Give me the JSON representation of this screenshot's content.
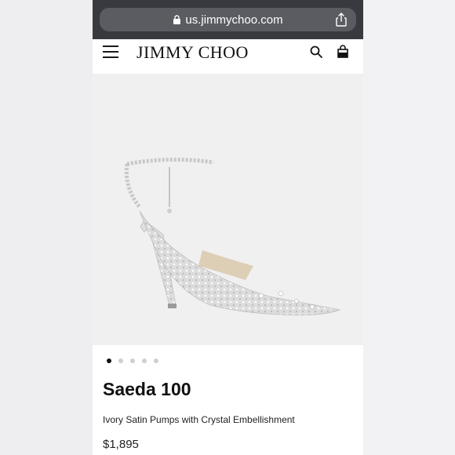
{
  "browser": {
    "url": "us.jimmychoo.com",
    "lock_icon": "lock-icon",
    "share_icon": "share-icon"
  },
  "header": {
    "brand": "JIMMY CHOO",
    "menu_icon": "hamburger-menu-icon",
    "search_icon": "search-icon",
    "bag_icon": "shopping-bag-icon"
  },
  "gallery": {
    "image_count": 5,
    "active_index": 0
  },
  "product": {
    "name": "Saeda 100",
    "description": "Ivory Satin Pumps with Crystal Embellishment",
    "price": "$1,895"
  },
  "colors": {
    "browser_bar": "#383a3f",
    "url_pill": "#5a5c61",
    "text": "#111111",
    "background": "#f0f0f0"
  }
}
